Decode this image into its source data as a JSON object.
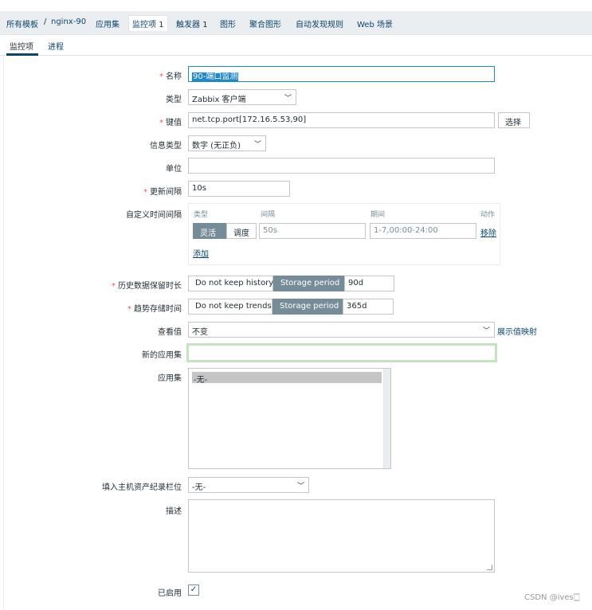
{
  "breadcrumb": {
    "all_templates": "所有模板",
    "separator": "/",
    "template": "nginx-90",
    "applications": "应用集",
    "items": "监控项",
    "items_count": "1",
    "triggers": "触发器",
    "triggers_count": "1",
    "graphs": "图形",
    "screens": "聚合图形",
    "discovery": "自动发现规则",
    "web": "Web 场景"
  },
  "tabs": {
    "item": "监控项",
    "process": "进程"
  },
  "form": {
    "name": {
      "label": "名称",
      "value": "90-端口监测"
    },
    "type": {
      "label": "类型",
      "value": "Zabbix 客户端"
    },
    "key": {
      "label": "键值",
      "value": "net.tcp.port[172.16.5.53,90]",
      "select_button": "选择"
    },
    "info_type": {
      "label": "信息类型",
      "value": "数字 (无正负)"
    },
    "units": {
      "label": "单位",
      "value": ""
    },
    "interval": {
      "label": "更新间隔",
      "value": "10s"
    },
    "custom_intervals": {
      "label": "自定义时间间隔",
      "headers": {
        "type": "类型",
        "interval": "间隔",
        "period": "期间",
        "action": "动作"
      },
      "flexible": "灵活",
      "scheduling": "调度",
      "interval_value": "50s",
      "period_value": "1-7,00:00-24:00",
      "remove": "移除",
      "add": "添加"
    },
    "history": {
      "label": "历史数据保留时长",
      "no_keep": "Do not keep history",
      "storage": "Storage period",
      "value": "90d"
    },
    "trends": {
      "label": "趋势存储时间",
      "no_keep": "Do not keep trends",
      "storage": "Storage period",
      "value": "365d"
    },
    "show_value": {
      "label": "查看值",
      "value": "不变",
      "link": "展示值映射"
    },
    "new_application": {
      "label": "新的应用集",
      "value": ""
    },
    "applications": {
      "label": "应用集",
      "options": [
        "-无-"
      ]
    },
    "inventory": {
      "label": "填入主机资产纪录栏位",
      "value": "-无-"
    },
    "description": {
      "label": "描述",
      "value": ""
    },
    "enabled": {
      "label": "已启用",
      "checked": true
    }
  },
  "required_marker": "*",
  "icons": {
    "chevron": "chevron-down-icon",
    "check": "check-icon"
  },
  "colors": {
    "accent": "#0a466a",
    "required": "#e45959",
    "segment_active": "#768d99"
  },
  "watermark": "CSDN @ives🀆"
}
